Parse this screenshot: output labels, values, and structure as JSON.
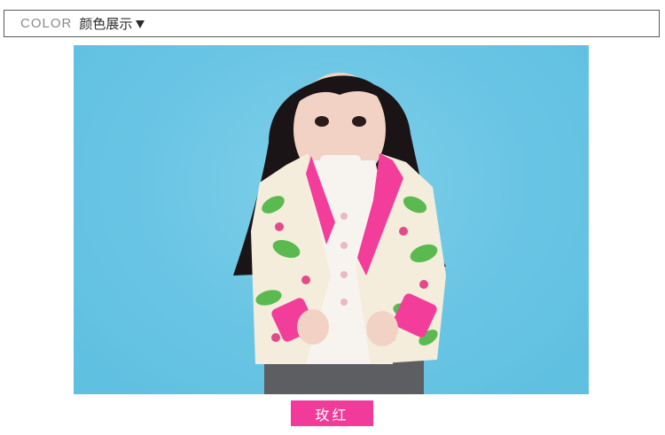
{
  "header": {
    "title_en": "COLOR",
    "title_cn": "颜色展示",
    "arrow_icon": "triangle-down-icon"
  },
  "product": {
    "image_alt": "",
    "color_name": "玫红",
    "accent_color": "#f13a9a"
  }
}
